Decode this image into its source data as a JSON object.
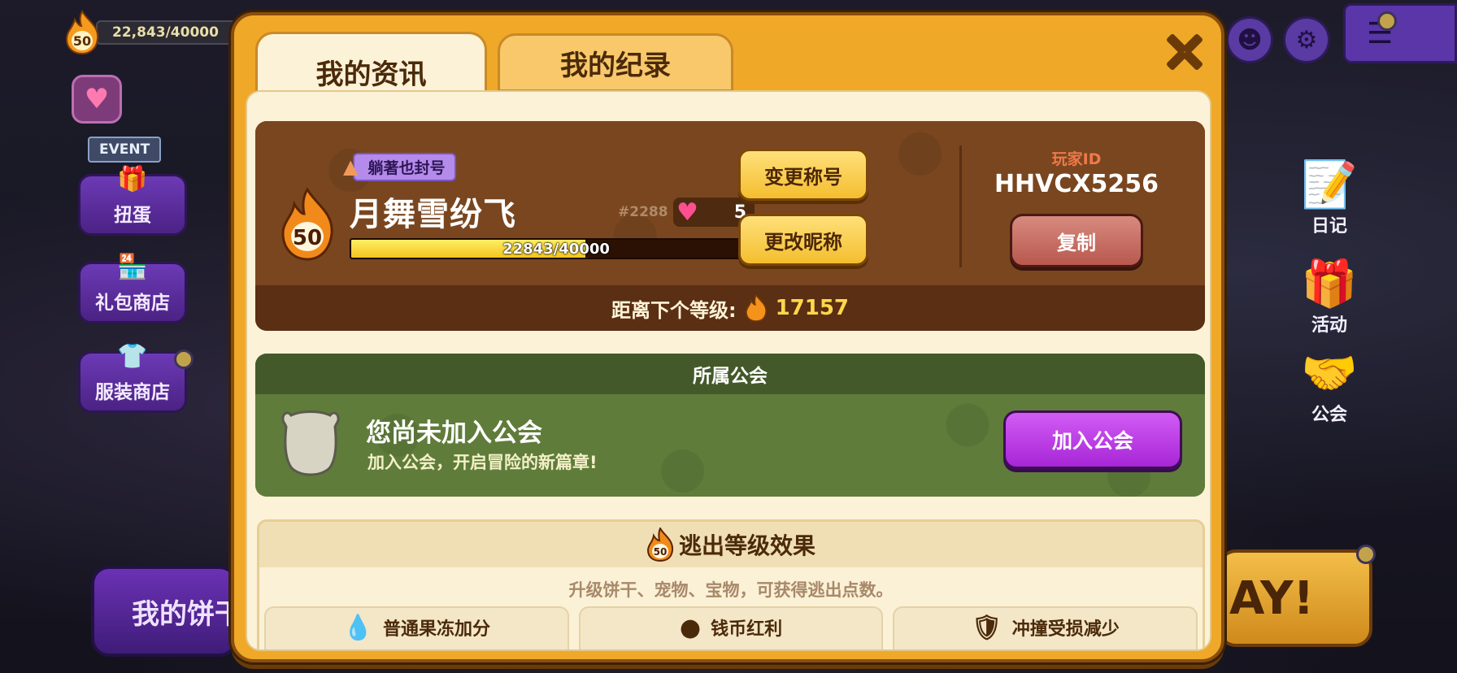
{
  "hud": {
    "level": "50",
    "exp_text": "22,843/40000"
  },
  "left_menu": {
    "event_label": "EVENT",
    "items": [
      {
        "label": "扭蛋"
      },
      {
        "label": "礼包商店"
      },
      {
        "label": "服装商店"
      }
    ],
    "bottom_button": "我的饼干"
  },
  "right_menu": {
    "items": [
      {
        "label": "日记"
      },
      {
        "label": "活动"
      },
      {
        "label": "公会"
      }
    ],
    "bottom_button": "AY!"
  },
  "modal": {
    "tabs": [
      {
        "label": "我的资讯",
        "active": true
      },
      {
        "label": "我的纪录",
        "active": false
      }
    ],
    "profile": {
      "title_badge": "躺著也封号",
      "level": "50",
      "name": "月舞雪纷飞",
      "tag": "#2288",
      "hearts": "5",
      "exp_text": "22843/40000",
      "exp_progress": 0.571,
      "change_title_label": "变更称号",
      "change_name_label": "更改昵称",
      "player_id_label": "玩家ID",
      "player_id": "HHVCX5256",
      "copy_label": "复制",
      "next_level_label": "距离下个等级:",
      "next_level_value": "17157"
    },
    "guild": {
      "header": "所属公会",
      "title": "您尚未加入公会",
      "subtitle": "加入公会，开启冒险的新篇章!",
      "join_label": "加入公会"
    },
    "escape": {
      "level": "50",
      "header": "逃出等级效果",
      "description": "升级饼干、宠物、宝物，可获得逃出点数。",
      "effects": [
        {
          "label": "普通果冻加分",
          "icon": "jelly-icon"
        },
        {
          "label": "钱币红利",
          "icon": "coin-icon"
        },
        {
          "label": "冲撞受损减少",
          "icon": "shield-icon"
        }
      ]
    }
  },
  "colors": {
    "modal_frame": "#f0a829",
    "profile_bg": "#79461f",
    "guild_bg": "#5f7c3a",
    "join_button": "#b73be3",
    "copy_button": "#c46b60",
    "exp_fill": "#f4cc2a"
  }
}
